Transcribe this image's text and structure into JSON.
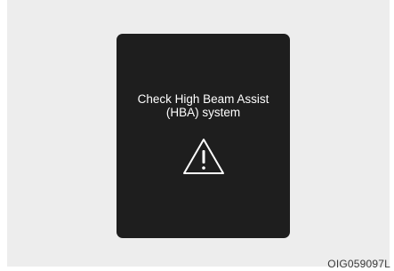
{
  "display": {
    "message_line1": "Check High Beam Assist",
    "message_line2": "(HBA) system",
    "icon": "warning-triangle-icon"
  },
  "figure": {
    "code": "OIG059097L"
  },
  "colors": {
    "background": "#ededed",
    "screen": "#1e1e1e",
    "text": "#ffffff"
  }
}
